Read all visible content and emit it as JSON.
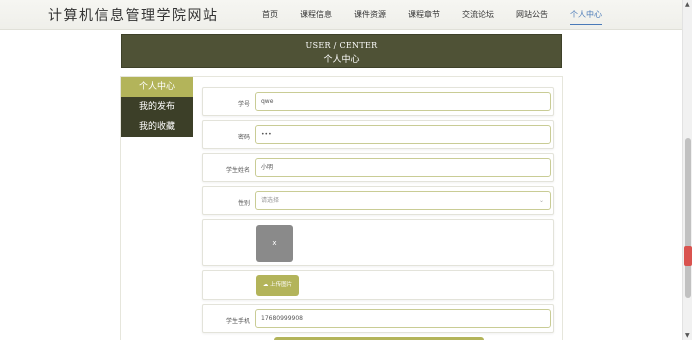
{
  "header": {
    "site_title": "计算机信息管理学院网站",
    "nav": [
      "首页",
      "课程信息",
      "课件资源",
      "课程章节",
      "交流论坛",
      "网站公告",
      "个人中心"
    ],
    "active_nav": "个人中心"
  },
  "banner": {
    "en": "USER / CENTER",
    "cn": "个人中心"
  },
  "sidebar": {
    "items": [
      "个人中心",
      "我的发布",
      "我的收藏"
    ],
    "active": "个人中心"
  },
  "form": {
    "student_id": {
      "label": "学号",
      "value": "qwe"
    },
    "password": {
      "label": "密码",
      "value": "•••"
    },
    "student_name": {
      "label": "学生姓名",
      "value": "小明"
    },
    "gender": {
      "label": "性别",
      "placeholder": "请选择"
    },
    "photo": {
      "glyph": "x"
    },
    "upload": {
      "label": "上传图片",
      "icon": "cloud-upload-icon"
    },
    "phone": {
      "label": "学生手机",
      "value": "17680999908"
    }
  },
  "colors": {
    "accent": "#b3b45a",
    "dark": "#3c3f28",
    "banner": "#4f5236",
    "active_nav": "#4a7ab8"
  }
}
